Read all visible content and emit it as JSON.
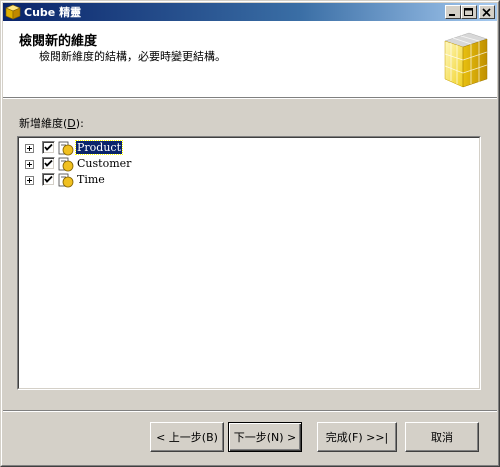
{
  "window": {
    "title": "Cube 精靈",
    "buttons": [
      "minimize",
      "maximize",
      "close"
    ]
  },
  "header": {
    "title": "檢閱新的維度",
    "subtitle": "檢閱新維度的結構，必要時變更結構。",
    "art_icon": "cube-grid-icon"
  },
  "dimensions": {
    "label": "新增維度(",
    "label_accel": "D",
    "label_tail": "):",
    "items": [
      {
        "name": "Product",
        "checked": true,
        "selected": true
      },
      {
        "name": "Customer",
        "checked": true,
        "selected": false
      },
      {
        "name": "Time",
        "checked": true,
        "selected": false
      }
    ]
  },
  "buttons": {
    "back": "< 上一步(B)",
    "next": "下一步(N) >",
    "finish": "完成(F) >>|",
    "cancel": "取消"
  },
  "colors": {
    "titlebar_start": "#0a246a",
    "titlebar_end": "#a6caf0",
    "selection": "#0a246a",
    "face": "#d4d0c8",
    "cube_yellow": "#f0d020"
  }
}
